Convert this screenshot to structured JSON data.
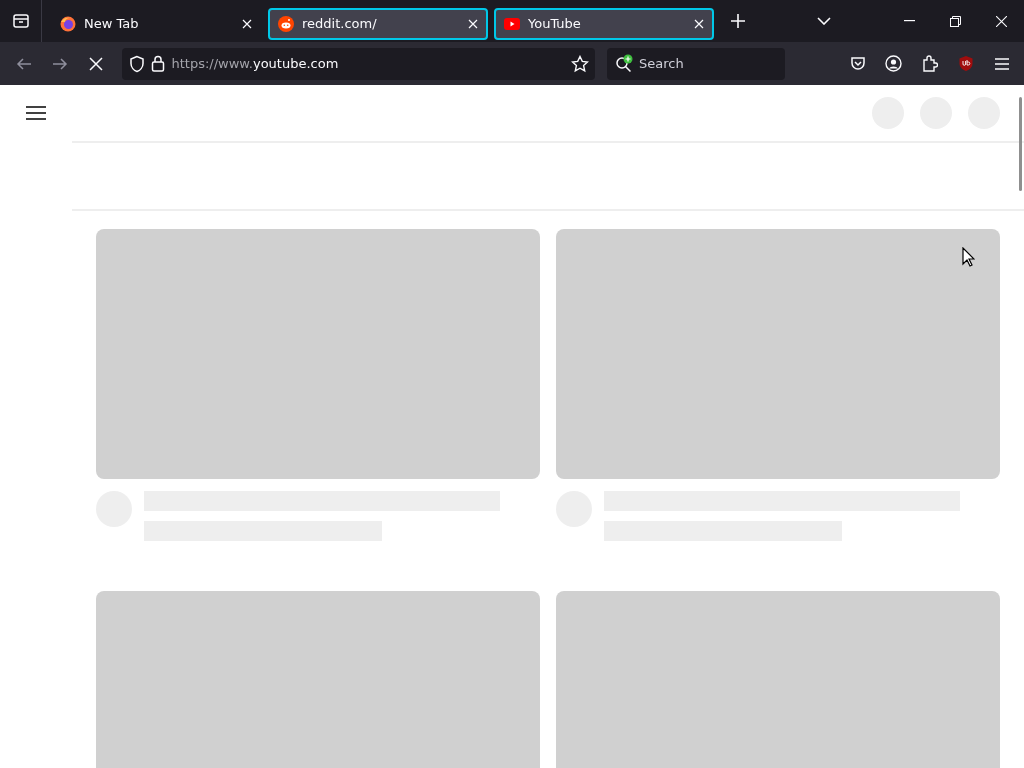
{
  "tabs": [
    {
      "title": "New Tab",
      "kind": "firefox",
      "selected": false
    },
    {
      "title": "reddit.com/",
      "kind": "reddit",
      "selected": true
    },
    {
      "title": "YouTube",
      "kind": "youtube",
      "selected": true
    }
  ],
  "navigation": {
    "back_disabled": true,
    "forward_disabled": true,
    "loading": true
  },
  "address_bar": {
    "scheme_prefix": "https://www.",
    "host": "youtube.com"
  },
  "search": {
    "placeholder": "Search"
  },
  "page": {
    "video_cards": [
      {
        "kind": "skeleton"
      },
      {
        "kind": "skeleton"
      },
      {
        "kind": "thumbnail_only"
      },
      {
        "kind": "thumbnail_only"
      }
    ]
  }
}
